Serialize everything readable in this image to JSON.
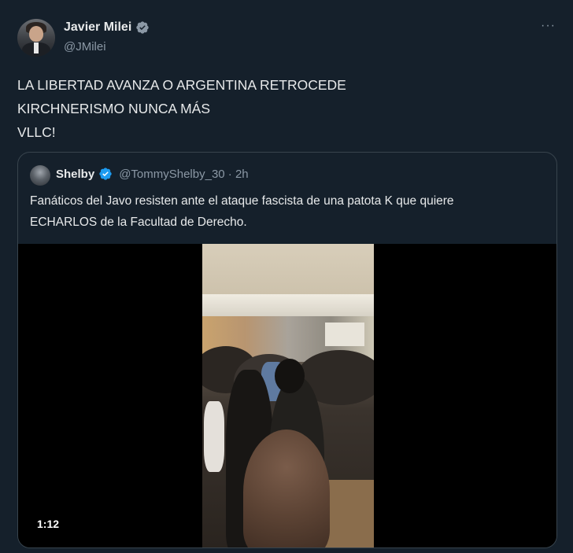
{
  "author": {
    "display_name": "Javier Milei",
    "handle": "@JMilei",
    "verified": true
  },
  "tweet": {
    "lines": [
      "LA LIBERTAD AVANZA O ARGENTINA RETROCEDE",
      "KIRCHNERISMO NUNCA MÁS",
      "VLLC!"
    ]
  },
  "quoted": {
    "display_name": "Shelby",
    "handle_time": "@TommyShelby_30 · 2h",
    "verified": true,
    "lines": [
      "Fanáticos del Javo resisten ante el ataque fascista de una patota K que quiere",
      "ECHARLOS de la Facultad de Derecho."
    ],
    "video": {
      "duration": "1:12"
    }
  },
  "colors": {
    "background": "#15202b",
    "text": "#e7e9ea",
    "secondary_text": "#8b98a5",
    "verified_badge": "#1d9bf0",
    "border": "#38444d"
  },
  "icons": {
    "verified": "verified-badge-icon",
    "more": "more-options-icon"
  }
}
